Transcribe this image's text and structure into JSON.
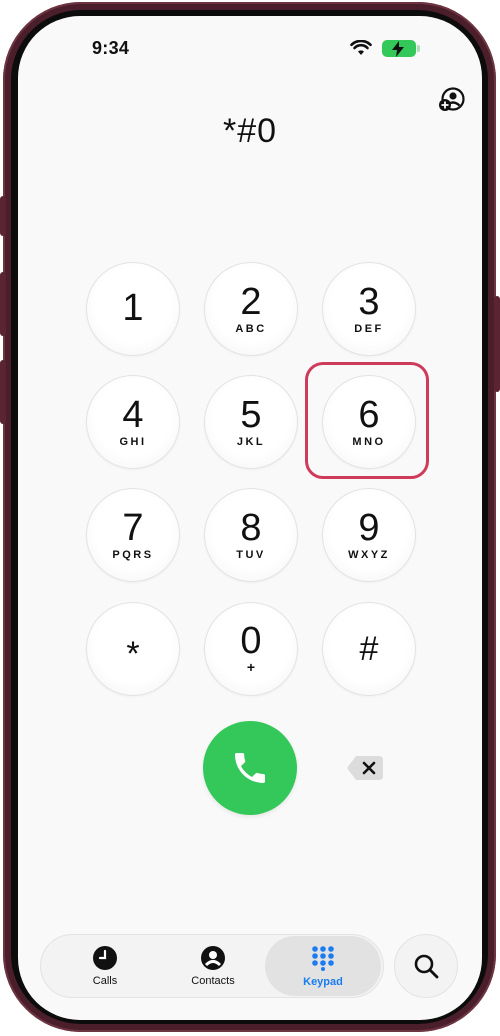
{
  "status": {
    "time": "9:34"
  },
  "display": {
    "number": "*#0"
  },
  "keys": [
    {
      "digit": "1",
      "letters": ""
    },
    {
      "digit": "2",
      "letters": "ABC"
    },
    {
      "digit": "3",
      "letters": "DEF"
    },
    {
      "digit": "4",
      "letters": "GHI"
    },
    {
      "digit": "5",
      "letters": "JKL"
    },
    {
      "digit": "6",
      "letters": "MNO"
    },
    {
      "digit": "7",
      "letters": "PQRS"
    },
    {
      "digit": "8",
      "letters": "TUV"
    },
    {
      "digit": "9",
      "letters": "WXYZ"
    },
    {
      "digit": "*",
      "letters": ""
    },
    {
      "digit": "0",
      "letters": "+"
    },
    {
      "digit": "#",
      "letters": ""
    }
  ],
  "tabs": [
    {
      "label": "Calls",
      "icon": "clock-icon"
    },
    {
      "label": "Contacts",
      "icon": "person-icon"
    },
    {
      "label": "Keypad",
      "icon": "keypad-icon",
      "active": true
    }
  ],
  "colors": {
    "call_green": "#34c759",
    "accent_blue": "#1a7cf0",
    "highlight": "#cf3b5a",
    "battery": "#34c759"
  }
}
